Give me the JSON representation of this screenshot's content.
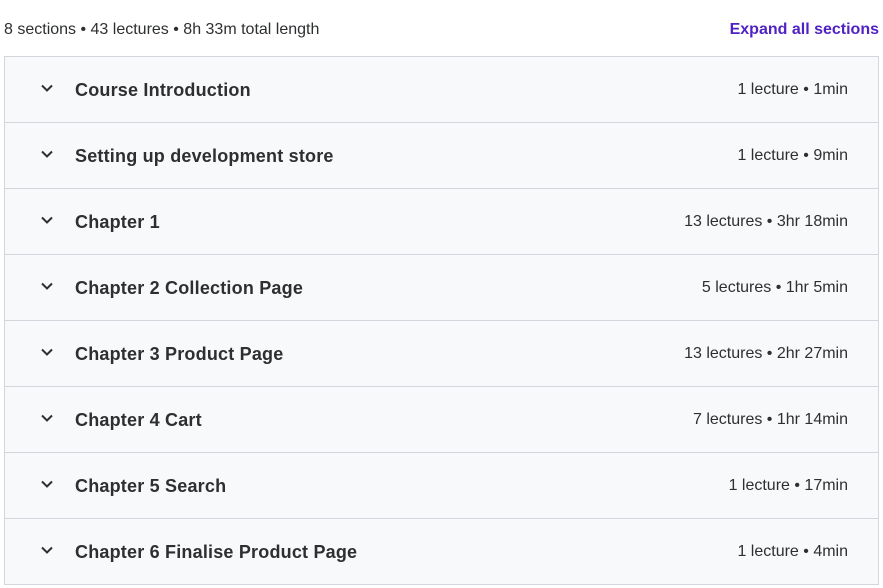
{
  "summary": "8 sections • 43 lectures • 8h 33m total length",
  "expand_all_label": "Expand all sections",
  "accent_color": "#5022c3",
  "sections": [
    {
      "title": "Course Introduction",
      "meta": "1 lecture • 1min"
    },
    {
      "title": "Setting up development store",
      "meta": "1 lecture • 9min"
    },
    {
      "title": "Chapter 1",
      "meta": "13 lectures • 3hr 18min"
    },
    {
      "title": "Chapter 2 Collection Page",
      "meta": "5 lectures • 1hr 5min"
    },
    {
      "title": "Chapter 3 Product Page",
      "meta": "13 lectures • 2hr 27min"
    },
    {
      "title": "Chapter 4 Cart",
      "meta": "7 lectures • 1hr 14min"
    },
    {
      "title": "Chapter 5 Search",
      "meta": "1 lecture • 17min"
    },
    {
      "title": "Chapter 6 Finalise Product Page",
      "meta": "1 lecture • 4min"
    }
  ]
}
